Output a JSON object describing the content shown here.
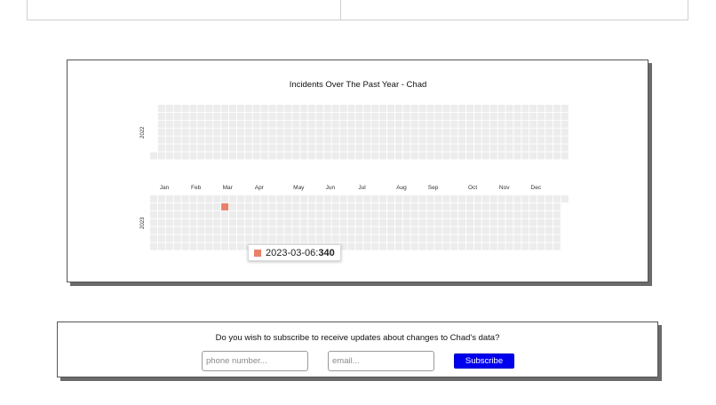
{
  "chart": {
    "title": "Incidents Over The Past Year - Chad",
    "years": [
      "2022",
      "2023"
    ],
    "months": [
      "Jan",
      "Feb",
      "Mar",
      "Apr",
      "May",
      "Jun",
      "Jul",
      "Aug",
      "Sep",
      "Oct",
      "Nov",
      "Dec"
    ],
    "empty_color": "#ececec",
    "highlight_color": "#e8806b"
  },
  "chart_data": {
    "type": "heatmap",
    "title": "Incidents Over The Past Year - Chad",
    "years": [
      "2022",
      "2023"
    ],
    "x_tick_labels": [
      "Jan",
      "Feb",
      "Mar",
      "Apr",
      "May",
      "Jun",
      "Jul",
      "Aug",
      "Sep",
      "Oct",
      "Nov",
      "Dec"
    ],
    "points": [
      {
        "date": "2023-03-06",
        "value": 340
      }
    ]
  },
  "tooltip": {
    "date_label": "2023-03-06: ",
    "value": "340"
  },
  "subscribe": {
    "question": "Do you wish to subscribe to receive updates about changes to Chad's data?",
    "phone_placeholder": "phone number...",
    "email_placeholder": "email...",
    "button_label": "Subscribe",
    "button_color": "#0000ee"
  }
}
